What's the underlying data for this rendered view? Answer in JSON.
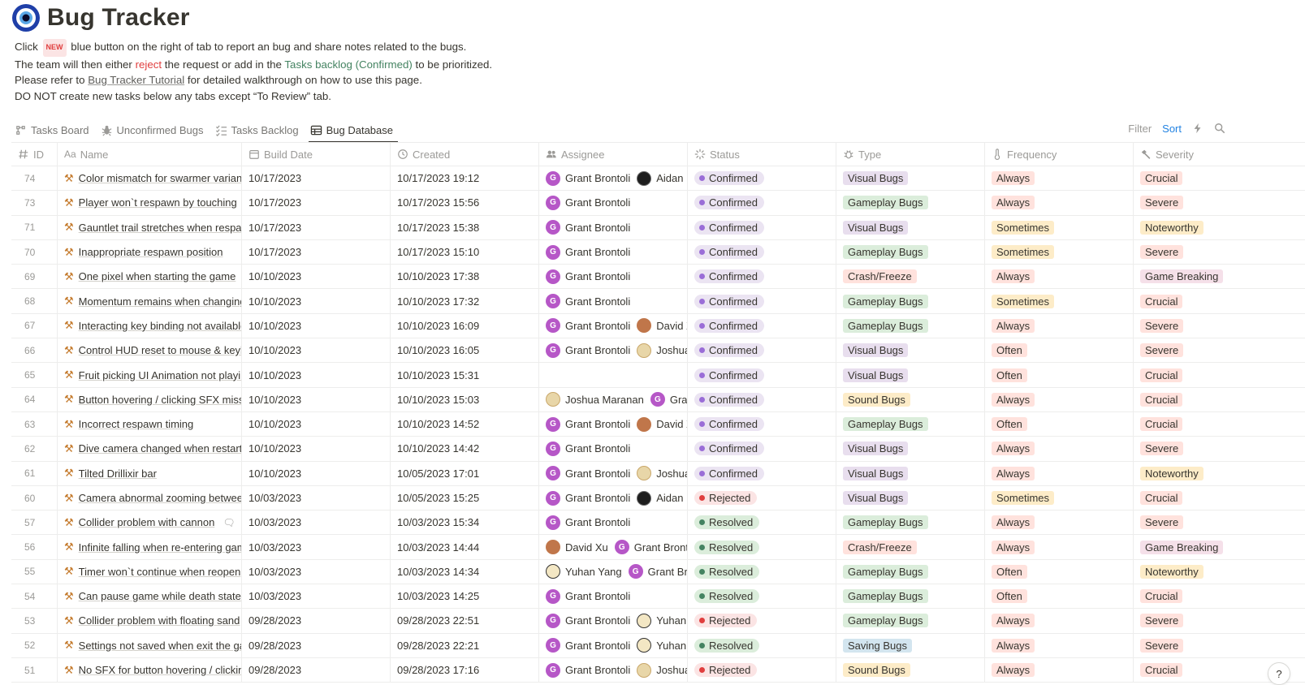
{
  "title": "Bug Tracker",
  "description": {
    "line1_pre": "Click",
    "new_badge": "NEW",
    "line1_post": "blue button on the right of tab to report an bug and share notes related to the bugs.",
    "line2_pre": "The team will then either",
    "reject": "reject",
    "line2_mid": "the request or add in the",
    "tasks_backlog": "Tasks backlog (Confirmed)",
    "line2_post": "to be prioritized.",
    "line3_pre": "Please refer to",
    "tutorial": "Bug Tracker Tutorial",
    "line3_post": "for detailed walkthrough on how to use this page.",
    "line4": "DO NOT create new tasks below any tabs except “To Review” tab."
  },
  "tabs": [
    {
      "label": "Tasks Board",
      "icon": "board-icon"
    },
    {
      "label": "Unconfirmed Bugs",
      "icon": "bug-icon"
    },
    {
      "label": "Tasks Backlog",
      "icon": "checklist-icon"
    },
    {
      "label": "Bug Database",
      "icon": "table-icon",
      "active": true
    }
  ],
  "toolbar": {
    "filter": "Filter",
    "sort": "Sort"
  },
  "columns": {
    "id": "ID",
    "name": "Name",
    "build": "Build Date",
    "created": "Created",
    "assignee": "Assignee",
    "status": "Status",
    "type": "Type",
    "frequency": "Frequency",
    "severity": "Severity"
  },
  "tag_colors": {
    "Visual Bugs": "purple",
    "Gameplay Bugs": "green",
    "Crash/Freeze": "red",
    "Sound Bugs": "yellow",
    "Saving Bugs": "blue",
    "Always": "red",
    "Sometimes": "yellow",
    "Often": "red",
    "Crucial": "red",
    "Severe": "red",
    "Noteworthy": "yellow",
    "Game Breaking": "pink"
  },
  "rows": [
    {
      "id": "74",
      "name": "Color mismatch for swarmer variant",
      "build": "10/17/2023",
      "created": "10/17/2023 19:12",
      "assignees": [
        {
          "n": "Grant Brontoli",
          "a": "g"
        },
        {
          "n": "Aidan H",
          "a": "a"
        }
      ],
      "status": "Confirmed",
      "type": "Visual Bugs",
      "freq": "Always",
      "sev": "Crucial"
    },
    {
      "id": "73",
      "name": "Player won`t respawn by touching",
      "build": "10/17/2023",
      "created": "10/17/2023 15:56",
      "assignees": [
        {
          "n": "Grant Brontoli",
          "a": "g"
        }
      ],
      "status": "Confirmed",
      "type": "Gameplay Bugs",
      "freq": "Always",
      "sev": "Severe"
    },
    {
      "id": "71",
      "name": "Gauntlet trail stretches when respawn",
      "build": "10/17/2023",
      "created": "10/17/2023 15:38",
      "assignees": [
        {
          "n": "Grant Brontoli",
          "a": "g"
        }
      ],
      "status": "Confirmed",
      "type": "Visual Bugs",
      "freq": "Sometimes",
      "sev": "Noteworthy"
    },
    {
      "id": "70",
      "name": "Inappropriate respawn position",
      "build": "10/17/2023",
      "created": "10/17/2023 15:10",
      "assignees": [
        {
          "n": "Grant Brontoli",
          "a": "g"
        }
      ],
      "status": "Confirmed",
      "type": "Gameplay Bugs",
      "freq": "Sometimes",
      "sev": "Severe"
    },
    {
      "id": "69",
      "name": "One pixel when starting the game",
      "build": "10/10/2023",
      "created": "10/10/2023 17:38",
      "assignees": [
        {
          "n": "Grant Brontoli",
          "a": "g"
        }
      ],
      "status": "Confirmed",
      "type": "Crash/Freeze",
      "freq": "Always",
      "sev": "Game Breaking"
    },
    {
      "id": "68",
      "name": "Momentum remains when changing",
      "build": "10/10/2023",
      "created": "10/10/2023 17:32",
      "assignees": [
        {
          "n": "Grant Brontoli",
          "a": "g"
        }
      ],
      "status": "Confirmed",
      "type": "Gameplay Bugs",
      "freq": "Sometimes",
      "sev": "Crucial"
    },
    {
      "id": "67",
      "name": "Interacting key binding not available",
      "build": "10/10/2023",
      "created": "10/10/2023 16:09",
      "assignees": [
        {
          "n": "Grant Brontoli",
          "a": "g"
        },
        {
          "n": "David Xu",
          "a": "d"
        }
      ],
      "status": "Confirmed",
      "type": "Gameplay Bugs",
      "freq": "Always",
      "sev": "Severe"
    },
    {
      "id": "66",
      "name": "Control HUD reset to mouse & keyboard",
      "build": "10/10/2023",
      "created": "10/10/2023 16:05",
      "assignees": [
        {
          "n": "Grant Brontoli",
          "a": "g"
        },
        {
          "n": "Joshua",
          "a": "j"
        }
      ],
      "status": "Confirmed",
      "type": "Visual Bugs",
      "freq": "Often",
      "sev": "Severe"
    },
    {
      "id": "65",
      "name": "Fruit picking UI Animation not playing",
      "build": "10/10/2023",
      "created": "10/10/2023 15:31",
      "assignees": [],
      "status": "Confirmed",
      "type": "Visual Bugs",
      "freq": "Often",
      "sev": "Crucial"
    },
    {
      "id": "64",
      "name": "Button hovering / clicking SFX missing",
      "build": "10/10/2023",
      "created": "10/10/2023 15:03",
      "assignees": [
        {
          "n": "Joshua Maranan",
          "a": "j"
        },
        {
          "n": "Grant",
          "a": "g"
        }
      ],
      "status": "Confirmed",
      "type": "Sound Bugs",
      "freq": "Always",
      "sev": "Crucial"
    },
    {
      "id": "63",
      "name": "Incorrect respawn timing",
      "build": "10/10/2023",
      "created": "10/10/2023 14:52",
      "assignees": [
        {
          "n": "Grant Brontoli",
          "a": "g"
        },
        {
          "n": "David Xu",
          "a": "d"
        }
      ],
      "status": "Confirmed",
      "type": "Gameplay Bugs",
      "freq": "Often",
      "sev": "Crucial"
    },
    {
      "id": "62",
      "name": "Dive camera changed when restarting",
      "build": "10/10/2023",
      "created": "10/10/2023 14:42",
      "assignees": [
        {
          "n": "Grant Brontoli",
          "a": "g"
        }
      ],
      "status": "Confirmed",
      "type": "Visual Bugs",
      "freq": "Always",
      "sev": "Severe"
    },
    {
      "id": "61",
      "name": "Tilted Drillixir bar",
      "build": "10/10/2023",
      "created": "10/05/2023 17:01",
      "assignees": [
        {
          "n": "Grant Brontoli",
          "a": "g"
        },
        {
          "n": "Joshua",
          "a": "j"
        }
      ],
      "status": "Confirmed",
      "type": "Visual Bugs",
      "freq": "Always",
      "sev": "Noteworthy"
    },
    {
      "id": "60",
      "name": "Camera abnormal zooming between",
      "build": "10/03/2023",
      "created": "10/05/2023 15:25",
      "assignees": [
        {
          "n": "Grant Brontoli",
          "a": "g"
        },
        {
          "n": "Aidan H",
          "a": "a"
        }
      ],
      "status": "Rejected",
      "type": "Visual Bugs",
      "freq": "Sometimes",
      "sev": "Crucial"
    },
    {
      "id": "57",
      "name": "Collider problem with cannon",
      "comment": true,
      "build": "10/03/2023",
      "created": "10/03/2023 15:34",
      "assignees": [
        {
          "n": "Grant Brontoli",
          "a": "g"
        }
      ],
      "status": "Resolved",
      "type": "Gameplay Bugs",
      "freq": "Always",
      "sev": "Severe"
    },
    {
      "id": "56",
      "name": "Infinite falling when re-entering game",
      "build": "10/03/2023",
      "created": "10/03/2023 14:44",
      "assignees": [
        {
          "n": "David Xu",
          "a": "d"
        },
        {
          "n": "Grant Brontoli",
          "a": "g"
        }
      ],
      "status": "Resolved",
      "type": "Crash/Freeze",
      "freq": "Always",
      "sev": "Game Breaking"
    },
    {
      "id": "55",
      "name": "Timer won`t continue when reopen",
      "build": "10/03/2023",
      "created": "10/03/2023 14:34",
      "assignees": [
        {
          "n": "Yuhan Yang",
          "a": "y"
        },
        {
          "n": "Grant Brontoli",
          "a": "g"
        }
      ],
      "status": "Resolved",
      "type": "Gameplay Bugs",
      "freq": "Often",
      "sev": "Noteworthy"
    },
    {
      "id": "54",
      "name": "Can pause game while death state",
      "build": "10/03/2023",
      "created": "10/03/2023 14:25",
      "assignees": [
        {
          "n": "Grant Brontoli",
          "a": "g"
        }
      ],
      "status": "Resolved",
      "type": "Gameplay Bugs",
      "freq": "Often",
      "sev": "Crucial"
    },
    {
      "id": "53",
      "name": "Collider problem with floating sand",
      "build": "09/28/2023",
      "created": "09/28/2023 22:51",
      "assignees": [
        {
          "n": "Grant Brontoli",
          "a": "g"
        },
        {
          "n": "Yuhan Yang",
          "a": "y"
        }
      ],
      "status": "Rejected",
      "type": "Gameplay Bugs",
      "freq": "Always",
      "sev": "Severe"
    },
    {
      "id": "52",
      "name": "Settings not saved when exit the game",
      "build": "09/28/2023",
      "created": "09/28/2023 22:21",
      "assignees": [
        {
          "n": "Grant Brontoli",
          "a": "g"
        },
        {
          "n": "Yuhan Yang",
          "a": "y"
        }
      ],
      "status": "Resolved",
      "type": "Saving Bugs",
      "freq": "Always",
      "sev": "Severe"
    },
    {
      "id": "51",
      "name": "No SFX for button hovering / clicking",
      "build": "09/28/2023",
      "created": "09/28/2023 17:16",
      "assignees": [
        {
          "n": "Grant Brontoli",
          "a": "g"
        },
        {
          "n": "Joshua",
          "a": "j"
        }
      ],
      "status": "Rejected",
      "type": "Sound Bugs",
      "freq": "Always",
      "sev": "Crucial"
    }
  ],
  "help": "?"
}
